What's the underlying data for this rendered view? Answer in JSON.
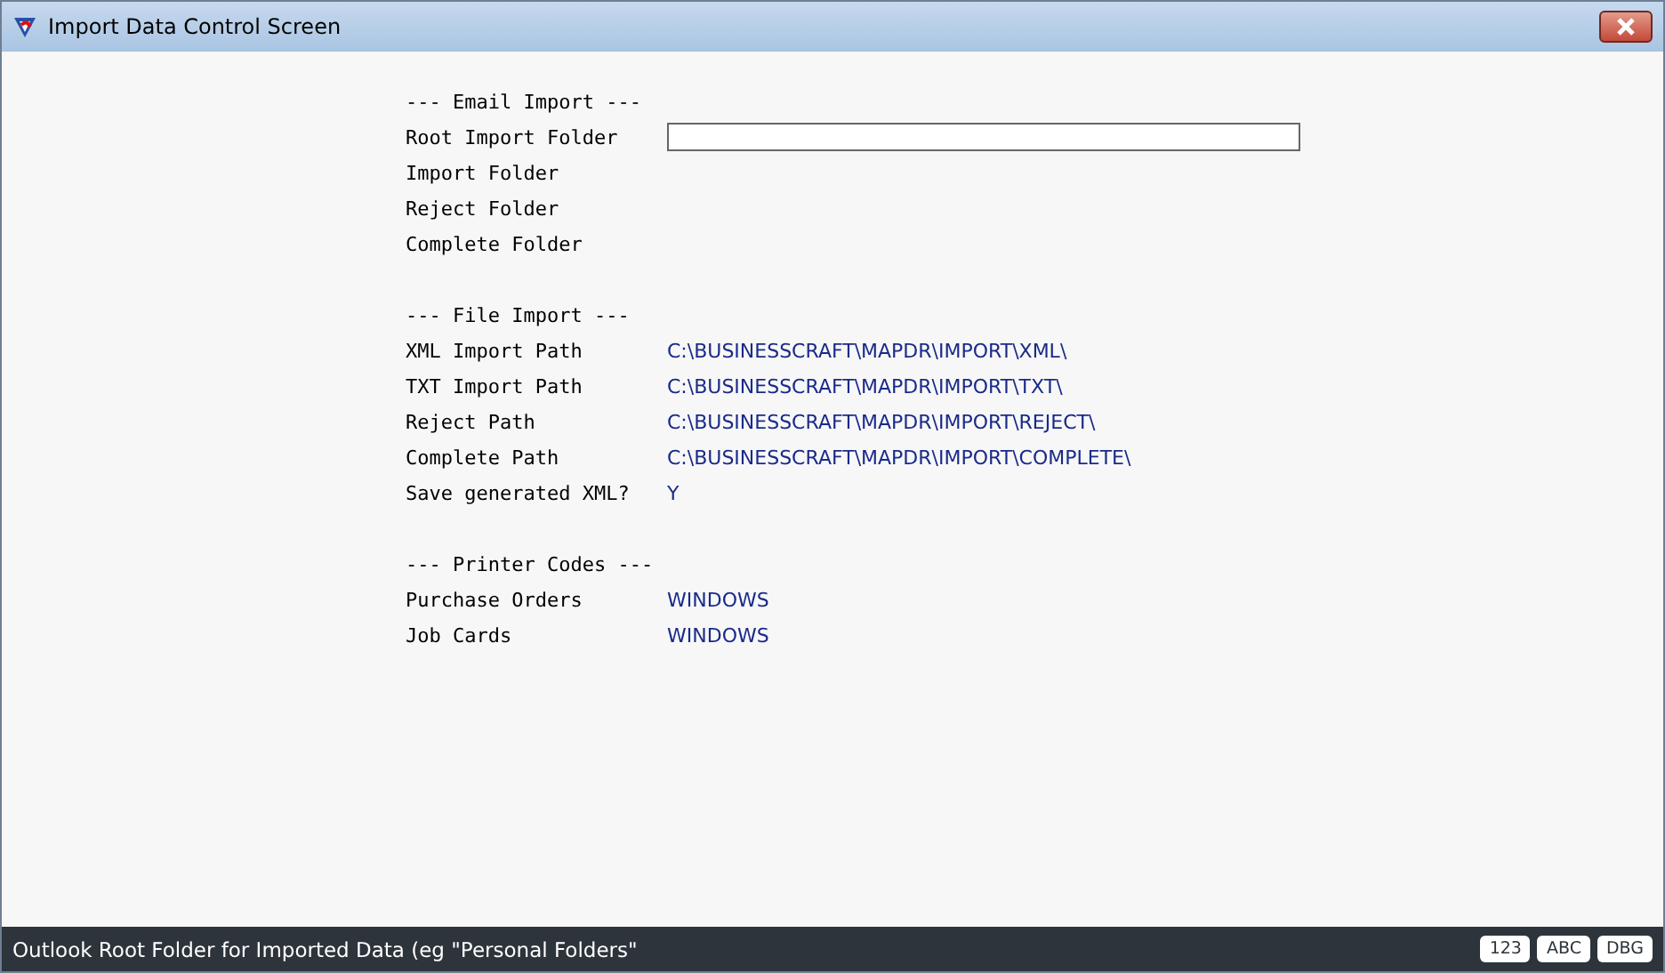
{
  "window": {
    "title": "Import Data Control Screen"
  },
  "sections": [
    {
      "heading": "--- Email Import ---",
      "rows": [
        {
          "label": "Root Import Folder",
          "kind": "input"
        },
        {
          "label": "Import Folder",
          "kind": "text"
        },
        {
          "label": "Reject Folder",
          "kind": "text"
        },
        {
          "label": "Complete Folder",
          "kind": "text"
        }
      ]
    },
    {
      "heading": "--- File Import ---",
      "rows": [
        {
          "label": "XML Import Path",
          "kind": "text",
          "value": "C:\\BUSINESSCRAFT\\MAPDR\\IMPORT\\XML\\"
        },
        {
          "label": "TXT Import Path",
          "kind": "text",
          "value": "C:\\BUSINESSCRAFT\\MAPDR\\IMPORT\\TXT\\"
        },
        {
          "label": "Reject Path",
          "kind": "text",
          "value": "C:\\BUSINESSCRAFT\\MAPDR\\IMPORT\\REJECT\\"
        },
        {
          "label": "Complete Path",
          "kind": "text",
          "value": "C:\\BUSINESSCRAFT\\MAPDR\\IMPORT\\COMPLETE\\"
        },
        {
          "label": "Save generated XML?",
          "kind": "text",
          "value": "Y"
        }
      ]
    },
    {
      "heading": "--- Printer Codes ---",
      "rows": [
        {
          "label": "Purchase Orders",
          "kind": "text",
          "value": "WINDOWS"
        },
        {
          "label": "Job Cards",
          "kind": "text",
          "value": "WINDOWS"
        }
      ]
    }
  ],
  "status_bar": {
    "message": "Outlook Root Folder for Imported Data (eg \"Personal Folders\"",
    "badges": [
      "123",
      "ABC",
      "DBG"
    ]
  }
}
